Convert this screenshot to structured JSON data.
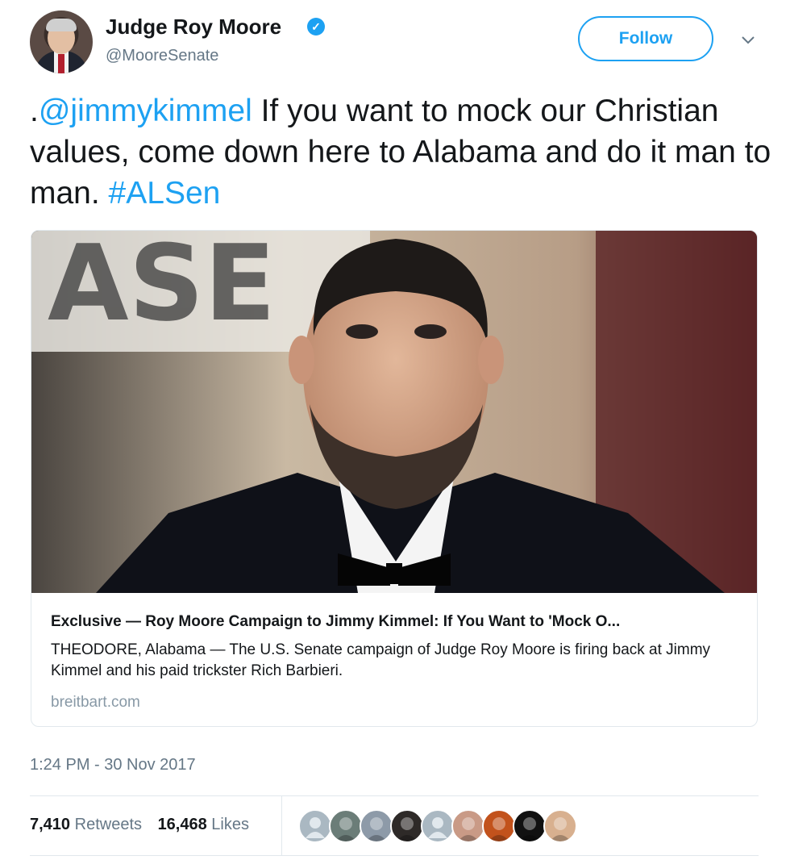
{
  "author": {
    "name": "Judge Roy Moore",
    "handle": "@MooreSenate",
    "verified_glyph": "✓"
  },
  "follow_label": "Follow",
  "tweet": {
    "prefix": ".",
    "mention": "@jimmykimmel",
    "body": " If you want to mock our Christian values, come down here to Alabama and do it man to man. ",
    "hashtag": "#ALSen"
  },
  "card": {
    "title": "Exclusive — Roy Moore Campaign to Jimmy Kimmel: If You Want to 'Mock O...",
    "description": "THEODORE, Alabama — The U.S. Senate campaign of Judge Roy Moore is firing back at Jimmy Kimmel and his paid trickster Rich Barbieri.",
    "domain": "breitbart.com",
    "image_background_text": "ASE"
  },
  "timestamp": "1:24 PM - 30 Nov 2017",
  "stats": {
    "retweets_count": "7,410",
    "retweets_label": "Retweets",
    "likes_count": "16,468",
    "likes_label": "Likes"
  },
  "colors": {
    "accent": "#1da1f2",
    "text": "#14171a",
    "muted": "#657786"
  },
  "likers": [
    {
      "name": "default-avatar",
      "color": "#aab8c2"
    },
    {
      "name": "liker-avatar",
      "color": "#6b7d78"
    },
    {
      "name": "liker-avatar",
      "color": "#8d9aa8"
    },
    {
      "name": "liker-avatar",
      "color": "#2e2a28"
    },
    {
      "name": "default-avatar",
      "color": "#aab8c2"
    },
    {
      "name": "liker-avatar",
      "color": "#c99a86"
    },
    {
      "name": "liker-avatar",
      "color": "#c2521c"
    },
    {
      "name": "liker-avatar",
      "color": "#111111"
    },
    {
      "name": "liker-avatar",
      "color": "#d8b08f"
    }
  ]
}
